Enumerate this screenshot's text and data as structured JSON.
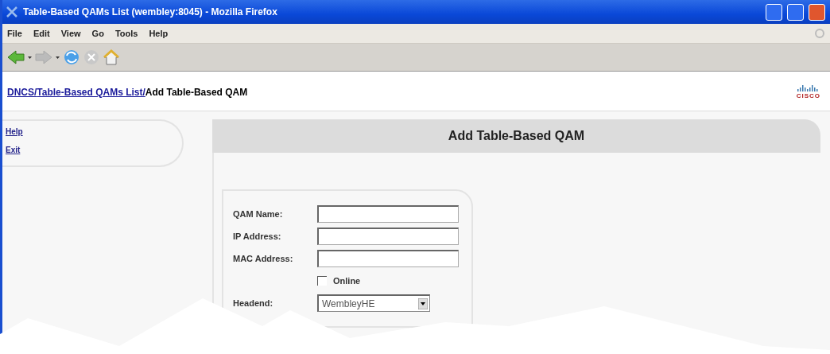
{
  "window": {
    "title": "Table-Based QAMs List (wembley:8045) - Mozilla Firefox"
  },
  "menu": [
    "File",
    "Edit",
    "View",
    "Go",
    "Tools",
    "Help"
  ],
  "breadcrumb": {
    "links": [
      "DNCS/",
      "Table-Based QAMs List/"
    ],
    "current": "Add Table-Based QAM"
  },
  "logo": {
    "text": "CISCO"
  },
  "sidebar": {
    "items": [
      "Help",
      "Exit"
    ]
  },
  "panel": {
    "title": "Add Table-Based QAM"
  },
  "form": {
    "fields": [
      {
        "kind": "text",
        "label": "QAM Name:"
      },
      {
        "kind": "text",
        "label": "IP Address:"
      },
      {
        "kind": "text",
        "label": "MAC Address:"
      },
      {
        "kind": "checkbox",
        "label": "Online",
        "checked": false
      },
      {
        "kind": "select",
        "label": "Headend:",
        "value": "WembleyHE"
      }
    ]
  }
}
